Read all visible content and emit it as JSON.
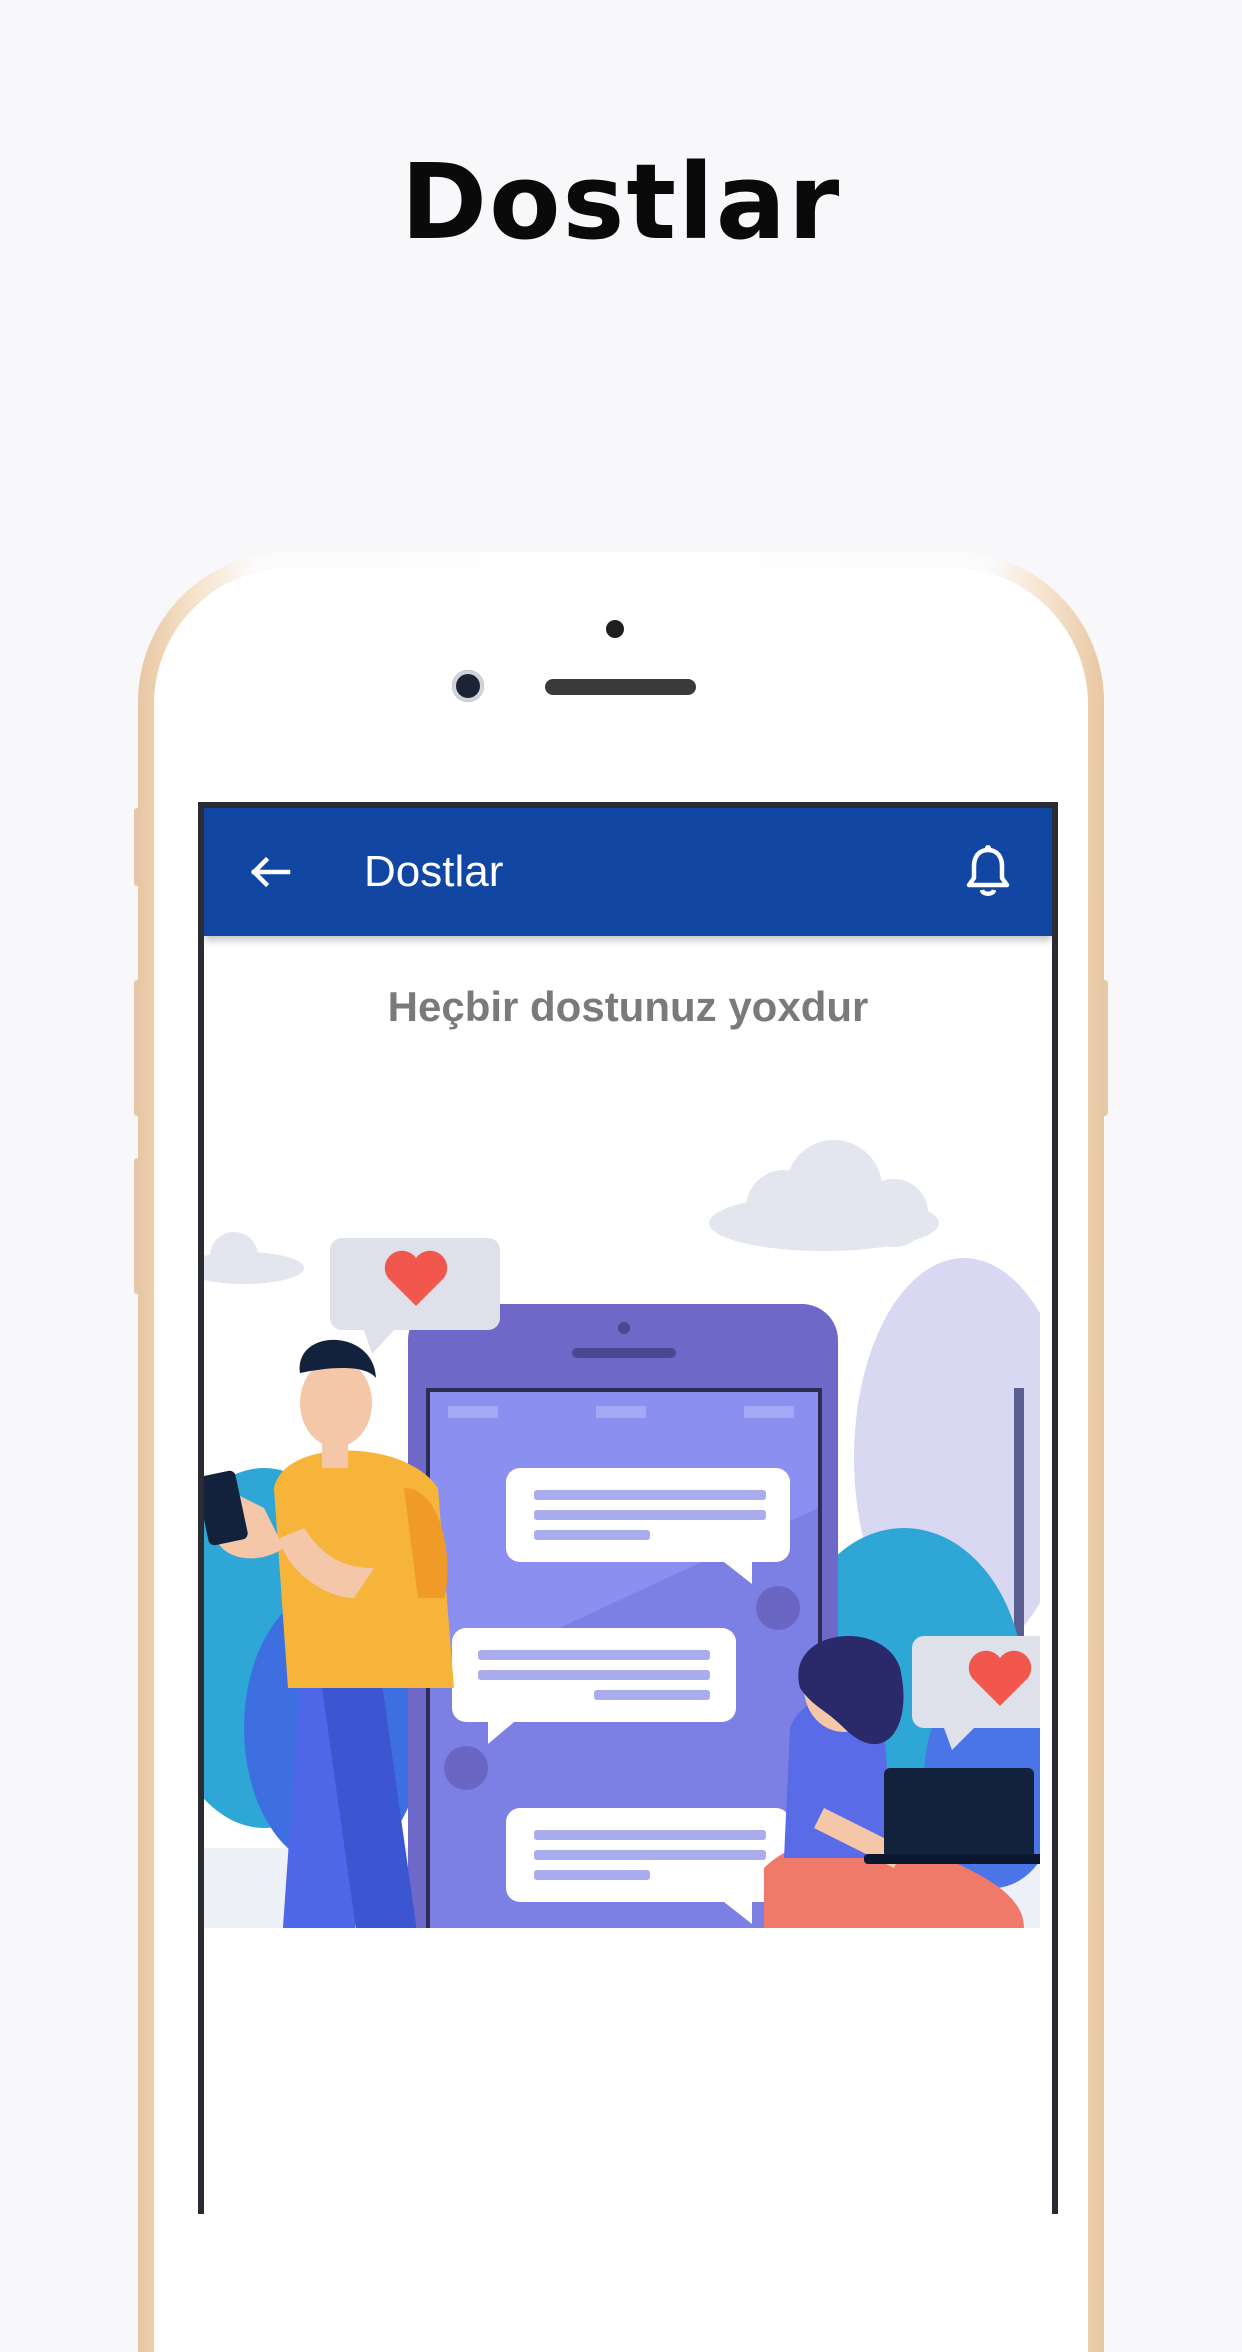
{
  "promo": {
    "title": "Dostlar"
  },
  "app": {
    "appbar": {
      "back_icon": "arrow-left-icon",
      "title": "Dostlar",
      "notification_icon": "bell-icon",
      "background": "#1146a3"
    },
    "empty_state": {
      "message": "Heçbir dostunuz yoxdur"
    }
  },
  "colors": {
    "accent": "#1146a3",
    "phone_frame": "#e8c7a3",
    "heart": "#f2574e",
    "illustration_phone": "#7b7fe0"
  }
}
